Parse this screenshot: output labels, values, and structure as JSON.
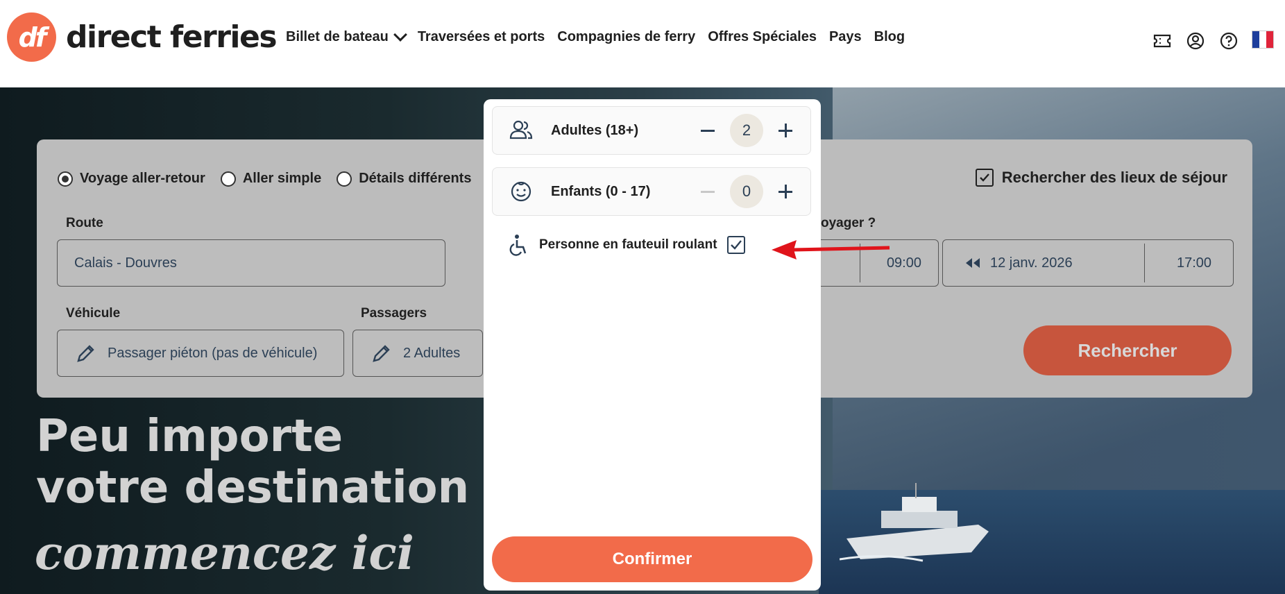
{
  "header": {
    "logo_mark": "df",
    "logo_text": "direct ferries",
    "nav": [
      {
        "label": "Billet de bateau",
        "has_dropdown": true
      },
      {
        "label": "Traversées et ports"
      },
      {
        "label": "Compagnies de ferry"
      },
      {
        "label": "Offres Spéciales"
      },
      {
        "label": "Pays"
      },
      {
        "label": "Blog"
      }
    ],
    "icons": [
      "ticket-icon",
      "account-icon",
      "help-icon",
      "france-flag-icon"
    ]
  },
  "search": {
    "trip_options": [
      {
        "label": "Voyage aller-retour",
        "selected": true
      },
      {
        "label": "Aller simple",
        "selected": false
      },
      {
        "label": "Détails différents",
        "selected": false
      }
    ],
    "stays_label": "Rechercher des lieux de séjour",
    "route_label": "Route",
    "route_value": "Calais - Douvres",
    "when_label": "oyager ?",
    "outbound_time": "09:00",
    "return_date": "12 janv. 2026",
    "return_time": "17:00",
    "vehicle_label": "Véhicule",
    "vehicle_value": "Passager piéton (pas de véhicule)",
    "passengers_label": "Passagers",
    "passengers_value": "2 Adultes",
    "search_button": "Rechercher"
  },
  "hero": {
    "title_line1": "Peu importe",
    "title_line2": "votre destination",
    "subtitle": "commencez ici"
  },
  "popup": {
    "adults_label": "Adultes (18+)",
    "adults_value": "2",
    "children_label": "Enfants (0 - 17)",
    "children_value": "0",
    "wheelchair_label": "Personne en fauteuil roulant",
    "wheelchair_checked": true,
    "confirm_button": "Confirmer"
  },
  "colors": {
    "brand_orange": "#f26b4a",
    "text_dark": "#1f1f1f",
    "field_text": "#2b3f55",
    "annotation_arrow": "#e0141b"
  }
}
